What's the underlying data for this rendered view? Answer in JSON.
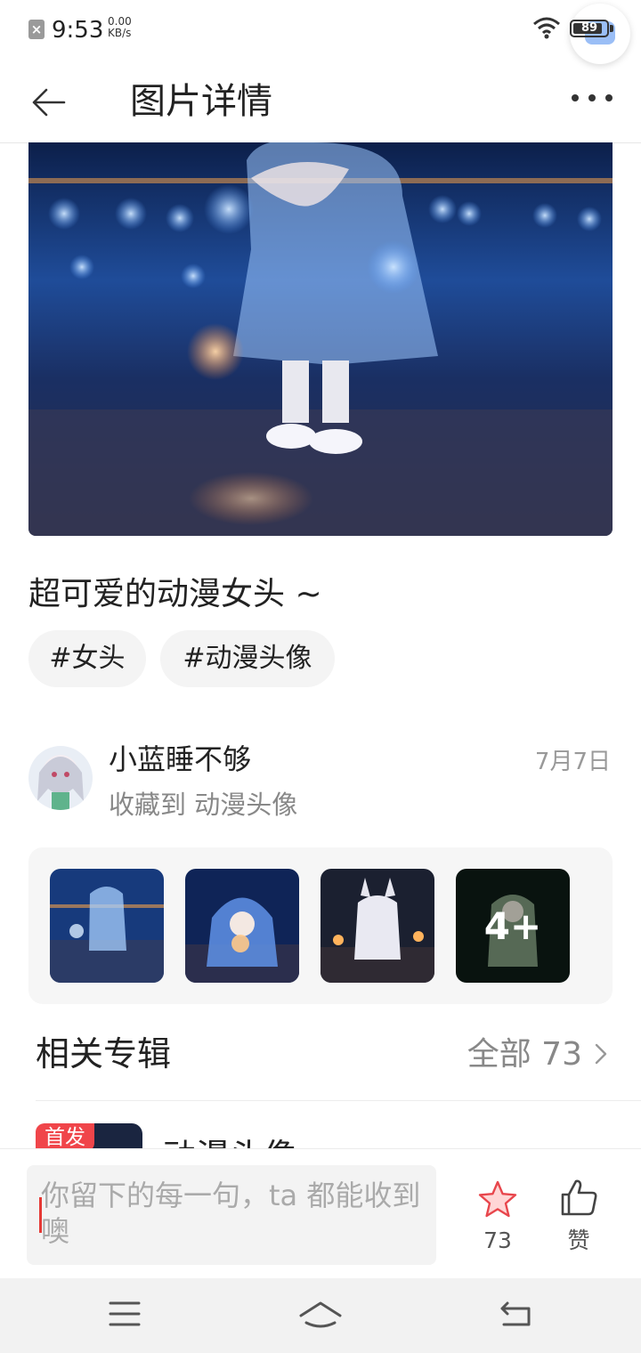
{
  "status_bar": {
    "time": "9:53",
    "net_speed": "0.00",
    "net_unit": "KB/s",
    "battery": "89",
    "battery_level": 0.89
  },
  "header": {
    "title": "图片详情",
    "back_icon": "arrow-left-icon",
    "more_icon": "more-dots-icon"
  },
  "post": {
    "caption": "超可爱的动漫女头 ~",
    "tags": [
      "#女头",
      "#动漫头像"
    ]
  },
  "author": {
    "name": "小蓝睡不够",
    "date": "7月7日",
    "collected_to": "收藏到 动漫头像"
  },
  "thumbnails": {
    "more_label": "4+"
  },
  "related": {
    "title": "相关专辑",
    "all_label": "全部 73",
    "album_badge": "首发",
    "album_name": "动漫头像"
  },
  "bottom_bar": {
    "comment_placeholder": "你留下的每一句，ta 都能收到噢",
    "favorite_count": "73",
    "like_label": "赞"
  },
  "colors": {
    "accent_red": "#f0454a",
    "star_fill": "#ffd6d6",
    "star_stroke": "#e8464c"
  }
}
